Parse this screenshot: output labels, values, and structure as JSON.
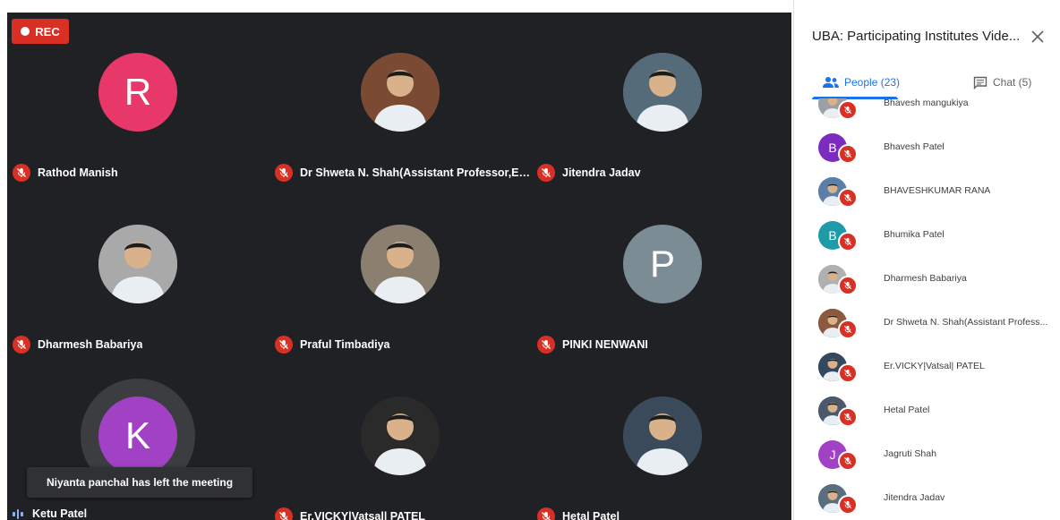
{
  "recording": {
    "label": "REC"
  },
  "tiles": [
    {
      "name": "Rathod Manish",
      "initial": "R",
      "avatar_color": "#e8386a",
      "photo": false
    },
    {
      "name": "Dr Shweta N. Shah(Assistant Professor,ECED...",
      "initial": "",
      "avatar_color": "#7a4a32",
      "photo": true
    },
    {
      "name": "Jitendra Jadav",
      "initial": "",
      "avatar_color": "#556b7a",
      "photo": true
    },
    {
      "name": "Dharmesh Babariya",
      "initial": "",
      "avatar_color": "#a9a9a9",
      "photo": true
    },
    {
      "name": "Praful Timbadiya",
      "initial": "",
      "avatar_color": "#8b8070",
      "photo": true
    },
    {
      "name": "PINKI NENWANI",
      "initial": "P",
      "avatar_color": "#7b8c95",
      "photo": false
    },
    {
      "name": "Ketu Patel",
      "initial": "K",
      "avatar_color": "#a142c4",
      "photo": false,
      "speaking": true
    },
    {
      "name": "Er.VICKY|Vatsal| PATEL",
      "initial": "",
      "avatar_color": "#2a2a2a",
      "photo": true
    },
    {
      "name": "Hetal Patel",
      "initial": "",
      "avatar_color": "#3a4a5a",
      "photo": true
    }
  ],
  "toast": {
    "text": "Niyanta panchal has left the meeting"
  },
  "panel": {
    "title": "UBA: Participating Institutes Vide...",
    "tabs": {
      "people": "People (23)",
      "chat": "Chat (5)"
    },
    "participants": [
      {
        "name": "Bhavesh mangukiya",
        "initial": "",
        "color": "#9aa0a6",
        "photo": true
      },
      {
        "name": "Bhavesh Patel",
        "initial": "B",
        "color": "#7b2cbf",
        "photo": false
      },
      {
        "name": "BHAVESHKUMAR RANA",
        "initial": "",
        "color": "#5b7fa8",
        "photo": true
      },
      {
        "name": "Bhumika Patel",
        "initial": "B",
        "color": "#1f9aa8",
        "photo": false
      },
      {
        "name": "Dharmesh Babariya",
        "initial": "",
        "color": "#b0b0b0",
        "photo": true
      },
      {
        "name": "Dr Shweta N. Shah(Assistant Profess...",
        "initial": "",
        "color": "#8a5a3c",
        "photo": true
      },
      {
        "name": "Er.VICKY|Vatsal| PATEL",
        "initial": "",
        "color": "#34495e",
        "photo": true
      },
      {
        "name": "Hetal Patel",
        "initial": "",
        "color": "#4a5a6a",
        "photo": true
      },
      {
        "name": "Jagruti Shah",
        "initial": "J",
        "color": "#a142c4",
        "photo": false
      },
      {
        "name": "Jitendra Jadav",
        "initial": "",
        "color": "#5a6e80",
        "photo": true
      }
    ]
  },
  "colors": {
    "grid_bg": "#202124",
    "muted_red": "#d93025",
    "accent_blue": "#1a73e8"
  }
}
